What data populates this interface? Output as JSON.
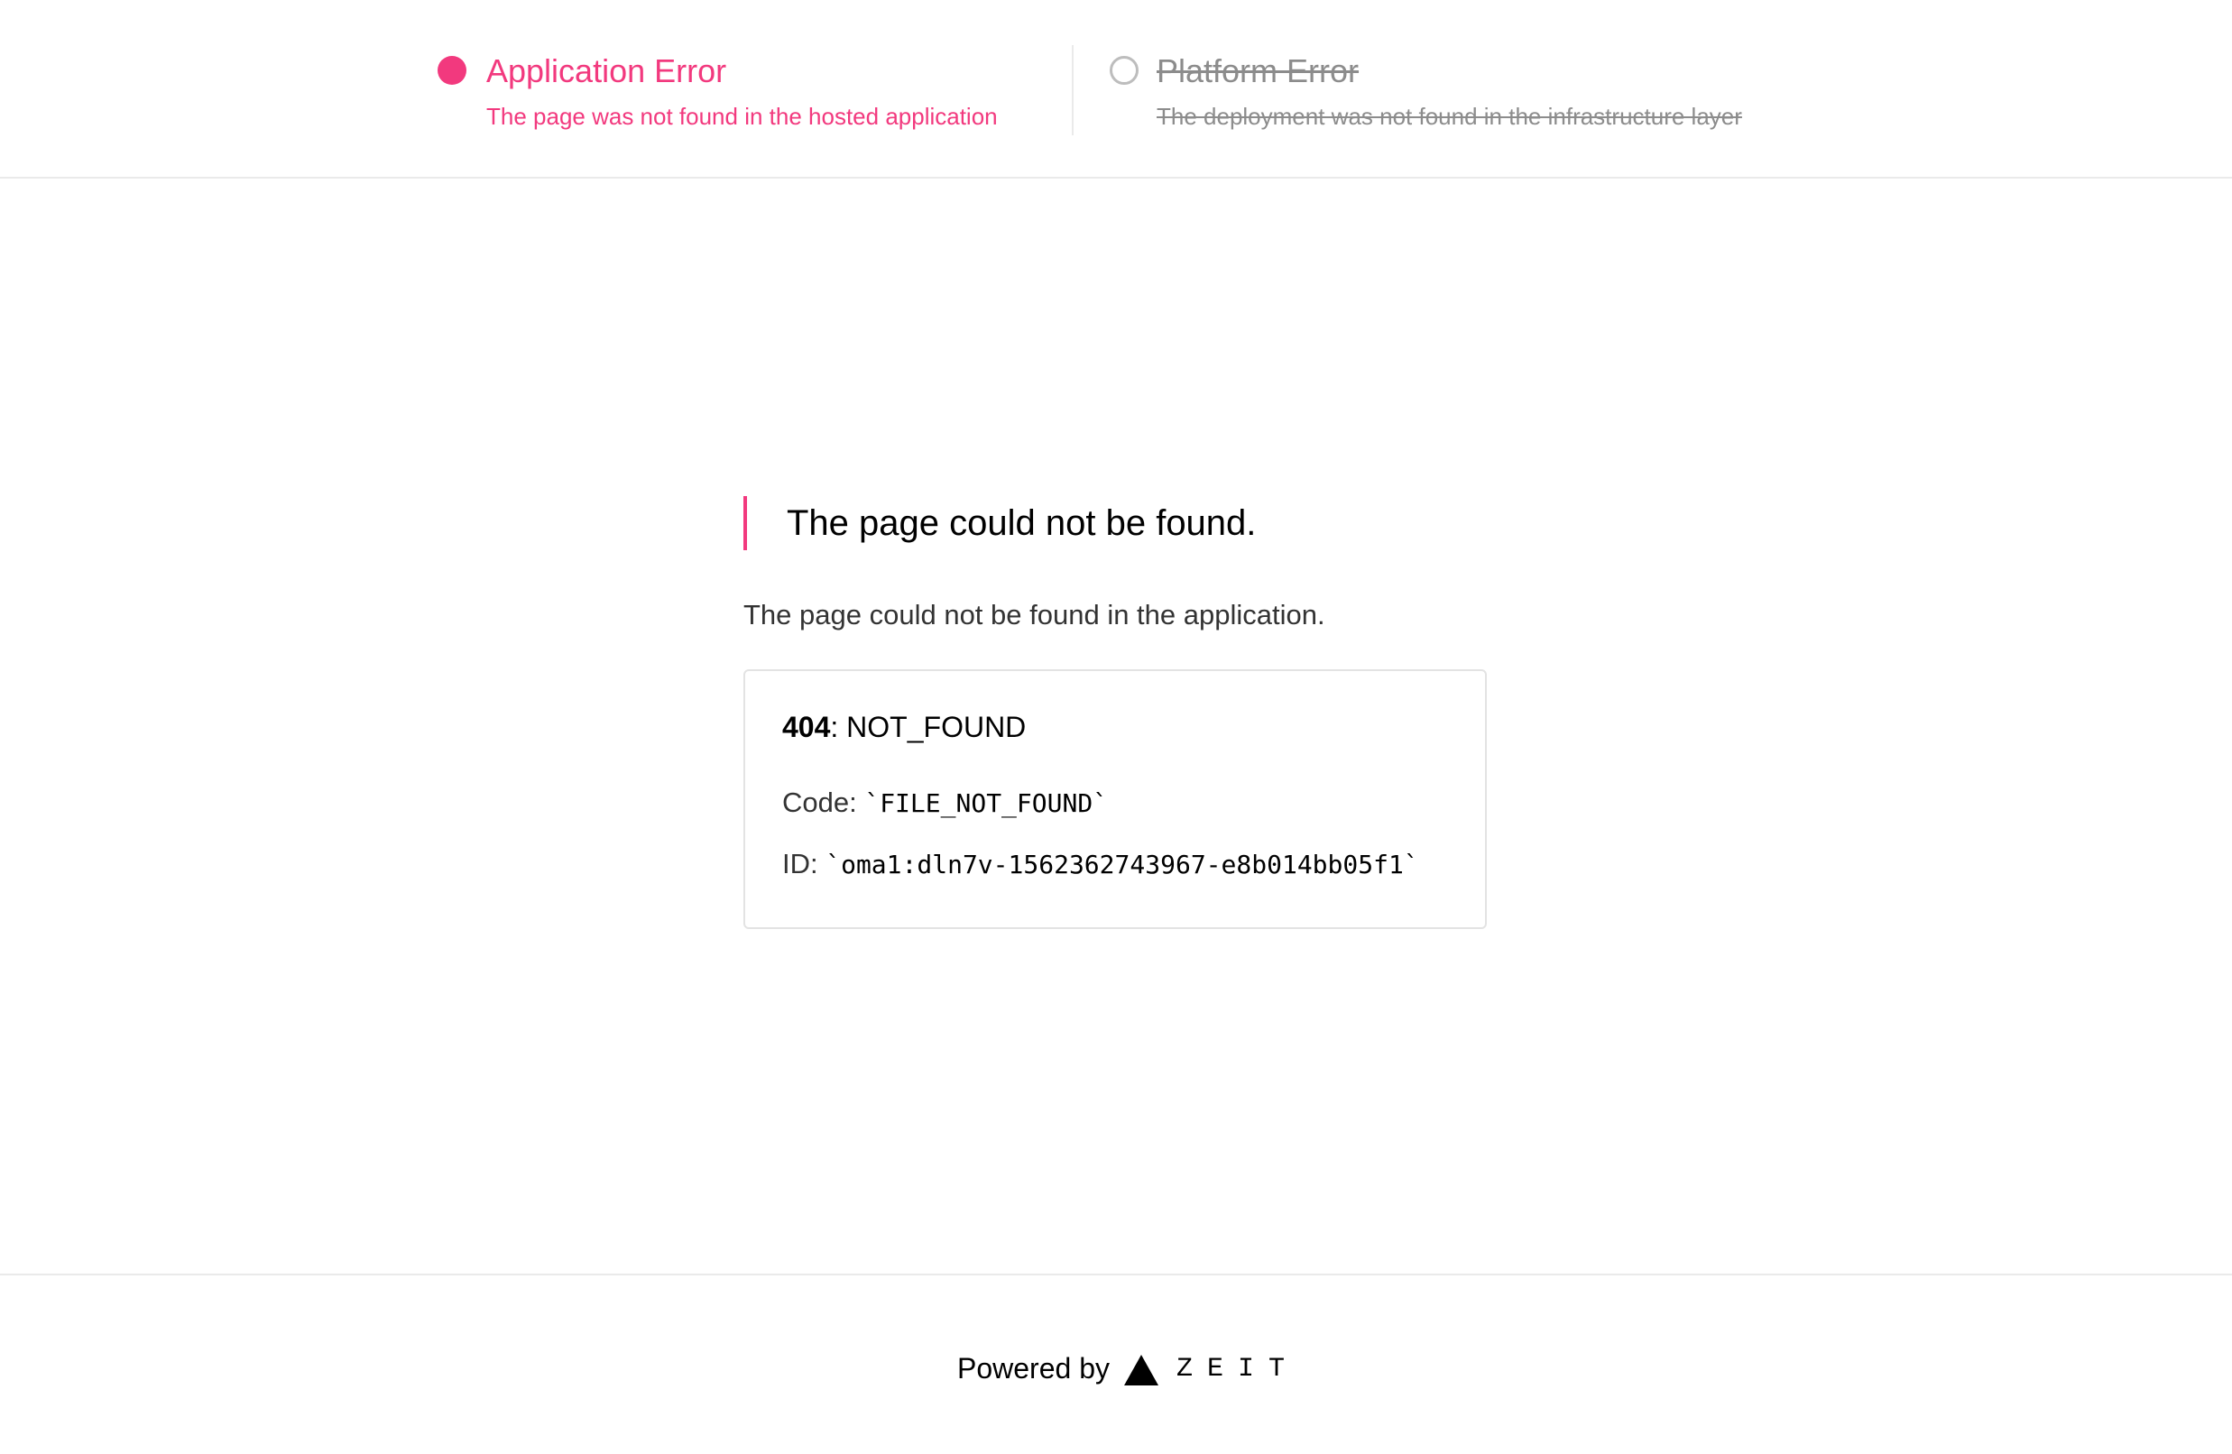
{
  "header": {
    "application_error": {
      "title": "Application Error",
      "description": "The page was not found in the hosted application",
      "state": "active"
    },
    "platform_error": {
      "title": "Platform Error",
      "description": "The deployment was not found in the infrastructure layer",
      "state": "inactive"
    }
  },
  "main": {
    "heading": "The page could not be found.",
    "description": "The page could not be found in the application.",
    "error_box": {
      "status_code": "404",
      "status_text": ": NOT_FOUND",
      "code_label": "Code: ",
      "code_value": "`FILE_NOT_FOUND`",
      "id_label": "ID: ",
      "id_value": "`oma1:dln7v-1562362743967-e8b014bb05f1`"
    }
  },
  "footer": {
    "powered_by": "Powered by",
    "brand_icon": "zeit-triangle-icon",
    "brand_name": "ZEIT"
  },
  "colors": {
    "accent": "#f2397e",
    "inactive": "#8c8c8c",
    "border": "#eaeaea"
  }
}
